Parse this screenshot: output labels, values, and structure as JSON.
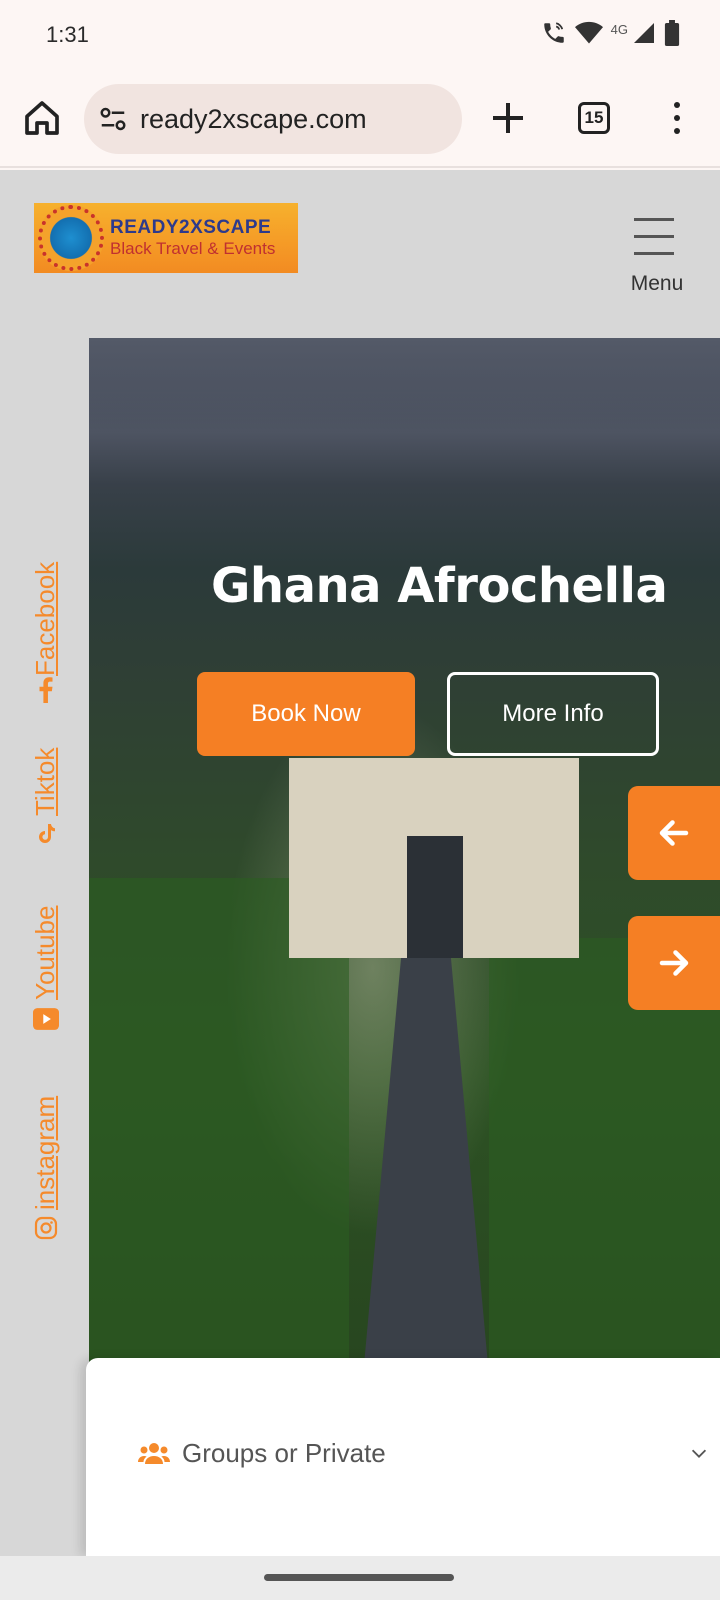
{
  "status_bar": {
    "time": "1:31",
    "network": "4G",
    "icons": [
      "wifi-calling-icon",
      "wifi-icon",
      "signal-icon",
      "battery-icon"
    ]
  },
  "browser": {
    "url": "ready2xscape.com",
    "tab_count": "15",
    "icons": [
      "home-icon",
      "site-settings-icon",
      "new-tab-icon",
      "overflow-menu-icon"
    ]
  },
  "header": {
    "logo_title": "READY2XSCAPE",
    "logo_subtitle": "Black Travel & Events",
    "menu_label": "Menu"
  },
  "social": [
    {
      "label": "Facebook",
      "icon": "facebook-icon"
    },
    {
      "label": "Tiktok",
      "icon": "tiktok-icon"
    },
    {
      "label": "Youtube",
      "icon": "youtube-icon"
    },
    {
      "label": "instagram",
      "icon": "instagram-icon"
    }
  ],
  "hero": {
    "title": "Ghana Afrochella",
    "book_label": "Book Now",
    "more_label": "More Info"
  },
  "booking": {
    "group_label": "Groups or Private"
  },
  "colors": {
    "accent": "#f57f24",
    "page_bg": "#d7d7d7",
    "browser_bg": "#fdf6f4"
  }
}
